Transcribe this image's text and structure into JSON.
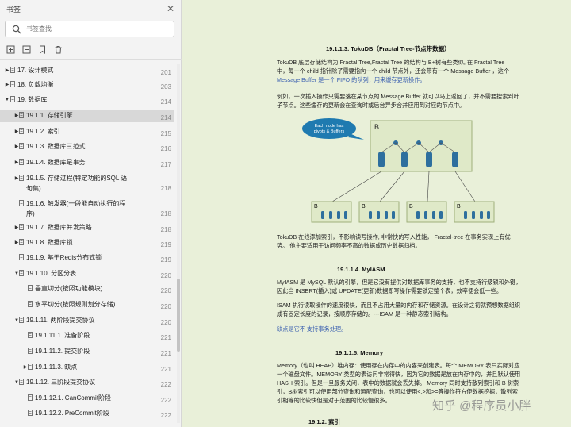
{
  "sidebar": {
    "title": "书签",
    "search_placeholder": "书签查找",
    "items": [
      {
        "label": "17. 设计模式",
        "page": "201",
        "indent": 0,
        "caret": "▶",
        "selected": false
      },
      {
        "label": "18. 负载均衡",
        "page": "203",
        "indent": 0,
        "caret": "▶",
        "selected": false
      },
      {
        "label": "19. 数据库",
        "page": "214",
        "indent": 0,
        "caret": "▼",
        "selected": false
      },
      {
        "label": "19.1.1. 存储引擎",
        "page": "214",
        "indent": 1,
        "caret": "▶",
        "selected": true
      },
      {
        "label": "19.1.2. 索引",
        "page": "215",
        "indent": 1,
        "caret": "▶",
        "selected": false
      },
      {
        "label": "19.1.3. 数据库三范式",
        "page": "216",
        "indent": 1,
        "caret": "▶",
        "selected": false
      },
      {
        "label": "19.1.4. 数据库是事务",
        "page": "217",
        "indent": 1,
        "caret": "▶",
        "selected": false
      },
      {
        "label": "19.1.5. 存储过程(特定功能的SQL 语",
        "label2": "句集)",
        "page": "218",
        "indent": 1,
        "caret": "▶",
        "selected": false
      },
      {
        "label": "19.1.6. 触发器(一段能自动执行的程",
        "label2": "序)",
        "page": "218",
        "indent": 1,
        "caret": "",
        "selected": false
      },
      {
        "label": "19.1.7. 数据库并发策略",
        "page": "218",
        "indent": 1,
        "caret": "▶",
        "selected": false
      },
      {
        "label": "19.1.8. 数据库锁",
        "page": "219",
        "indent": 1,
        "caret": "▶",
        "selected": false
      },
      {
        "label": "19.1.9. 基于Redis分布式锁",
        "page": "219",
        "indent": 1,
        "caret": "",
        "selected": false
      },
      {
        "label": "19.1.10. 分区分表",
        "page": "220",
        "indent": 1,
        "caret": "▼",
        "selected": false
      },
      {
        "label": "垂直切分(按照功能模块)",
        "page": "220",
        "indent": 2,
        "caret": "",
        "selected": false
      },
      {
        "label": "水平切分(按照规则划分存储)",
        "page": "220",
        "indent": 2,
        "caret": "",
        "selected": false
      },
      {
        "label": "19.1.11. 两阶段提交协议",
        "page": "220",
        "indent": 1,
        "caret": "▼",
        "selected": false
      },
      {
        "label": "19.1.11.1. 准备阶段",
        "page": "221",
        "indent": 2,
        "caret": "",
        "selected": false
      },
      {
        "label": "19.1.11.2. 提交阶段",
        "page": "221",
        "indent": 2,
        "caret": "",
        "selected": false
      },
      {
        "label": "19.1.11.3. 缺点",
        "page": "221",
        "indent": 2,
        "caret": "▶",
        "selected": false
      },
      {
        "label": "19.1.12. 三阶段提交协议",
        "page": "222",
        "indent": 1,
        "caret": "▼",
        "selected": false
      },
      {
        "label": "19.1.12.1. CanCommit阶段",
        "page": "222",
        "indent": 2,
        "caret": "",
        "selected": false
      },
      {
        "label": "19.1.12.2. PreCommit阶段",
        "page": "222",
        "indent": 2,
        "caret": "",
        "selected": false
      }
    ]
  },
  "doc": {
    "h1": "19.1.1.3.  TokuDB（Fractal Tree-节点带数据）",
    "p1a": "TokuDB 底层存储结构为 Fractal Tree,Fractal Tree 的结构与 B+树有些类似, 在 Fractal Tree",
    "p1b": "中，每一个 child 指针除了需要指向一个 child 节点外，还会带有一个 Message Buffer ，这个",
    "p1c": "Message Buffer 是一个 FIFO 的队列，用来缓存更新操作。",
    "p2a": "例如，一次插入操作只需要落在某节点的 Message Buffer 就可以马上返回了，并不需要搜索到叶",
    "p2b": "子节点。这些缓存的更新会在查询时或后台异步合并应用到对应的节点中。",
    "diagram_callout_1": "Each node has",
    "diagram_callout_2": "pivots & Buffers",
    "diagram_b": "B",
    "p3a": "TokuDB 在线添加索引，不影响读写操作, 非常快的写入性能， Fractal-tree 在事务实现上有优",
    "p3b": "势。 他主要适用于访问频率不高的数据或历史数据归档。",
    "h2": "19.1.1.4.     MyIASM",
    "p4a": "MyIASM 是 MySQL 默认的引擎，但是它没有提供对数据库事务的支持，也不支持行级锁和外键，",
    "p4b": "因此当 INSERT(插入)或 UPDATE(更新)数据即写操作需要锁定整个表，效率便会低一些。",
    "p5a": "ISAM 执行读取操作的速度很快，而且不占用大量的内存和存储资源。在设计之初就预想数据组织",
    "p5b": "成有固定长度的记录，按顺序存储的。---ISAM 是一种静态索引结构。",
    "p6": "缺点是它不 支持事务处理。",
    "h3": "19.1.1.5.     Memory",
    "p7a": "Memory（也叫 HEAP）堆内存：使用存在内存中的内容来创建表。每个 MEMORY 表只实际对应",
    "p7b": "一个磁盘文件。MEMORY 类型的表访问非常得快，因为它的数据是放在内存中的，并且默认使用",
    "p7c": "HASH 索引。但是一旦服务关闭，表中的数据就会丢失掉。  Memory 同时支持散列索引和 B 树索",
    "p7d": "引，B树索引可以使用部分查询和通配查询，也可以使用<,>和>=等操作符方便数据挖掘，散列索",
    "p7e": "引相等的比较快但是对于范围的比较慢很多。",
    "h4": "19.1.2.     索引"
  },
  "watermark": "知乎 @程序员小胖",
  "colors": {
    "sidebar_bg": "#f3f3f3",
    "page_bg": "#e9f0d9",
    "diagram_bg": "#dfe9c8",
    "node_blue": "#2e6f9e",
    "callout": "#1f7ab0"
  }
}
